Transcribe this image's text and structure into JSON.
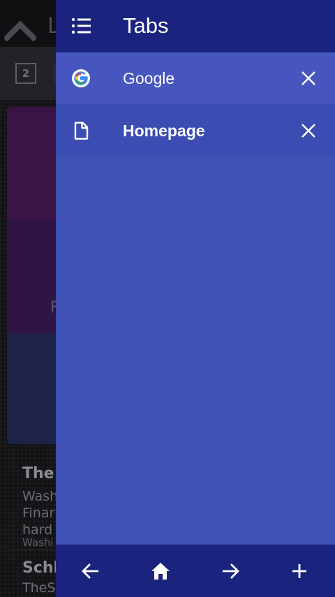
{
  "background": {
    "page_title": "L",
    "tab_count": "2",
    "card_letter": "F",
    "article1": {
      "headline": "The",
      "line1": "Wash",
      "line2": "Finar",
      "line3": "hard",
      "source": "Washi"
    },
    "article2": {
      "headline": "Schl",
      "line1": "TheS"
    }
  },
  "drawer": {
    "title": "Tabs",
    "tabs": [
      {
        "label": "Google",
        "favicon": "google-icon",
        "active": false
      },
      {
        "label": "Homepage",
        "favicon": "page-icon",
        "active": true
      }
    ]
  },
  "bottom_bar": {
    "buttons": [
      "back-arrow-icon",
      "home-icon",
      "forward-arrow-icon",
      "plus-icon"
    ]
  },
  "colors": {
    "drawer_bg": "#3f51b5",
    "drawer_header": "#1a237e",
    "text": "#ffffff"
  }
}
